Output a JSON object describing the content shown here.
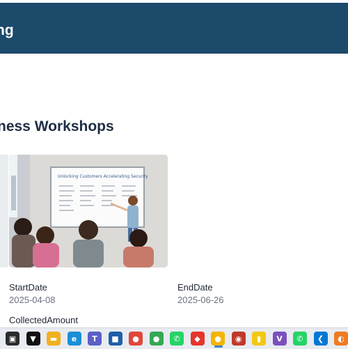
{
  "header": {
    "title": "ng"
  },
  "page": {
    "section_title": "ness Workshops"
  },
  "card": {
    "image_alt": "Workshop presenter at whiteboard with audience",
    "whiteboard_heading": "Unlocking Customers Accelerating Security"
  },
  "fields": {
    "start_label": "StartDate",
    "start_value": "2025-04-08",
    "end_label": "EndDate",
    "end_value": "2025-06-26",
    "collected_label": "CollectedAmount"
  },
  "taskbar": {
    "icons": [
      {
        "name": "task-view-icon",
        "color": "#2b2b2b",
        "glyph": "▣"
      },
      {
        "name": "store-icon",
        "color": "#111111",
        "glyph": "▼"
      },
      {
        "name": "file-explorer-icon",
        "color": "#f2b01e",
        "glyph": "▬"
      },
      {
        "name": "edge-icon",
        "color": "#1b8fd6",
        "glyph": "e"
      },
      {
        "name": "teams-icon",
        "color": "#5b5fc7",
        "glyph": "T"
      },
      {
        "name": "app-blue-icon",
        "color": "#1f5fa8",
        "glyph": "■"
      },
      {
        "name": "chrome-icon",
        "color": "#e2463a",
        "glyph": "●"
      },
      {
        "name": "chrome-profile-icon",
        "color": "#34a853",
        "glyph": "●"
      },
      {
        "name": "whatsapp-icon",
        "color": "#25d366",
        "glyph": "✆"
      },
      {
        "name": "anydesk-icon",
        "color": "#e5352b",
        "glyph": "◆"
      },
      {
        "name": "chrome-active-icon",
        "color": "#f4b400",
        "glyph": "●"
      },
      {
        "name": "app-red-icon",
        "color": "#c0392b",
        "glyph": "◉"
      },
      {
        "name": "power-bi-icon",
        "color": "#f2c811",
        "glyph": "▮"
      },
      {
        "name": "vs-icon",
        "color": "#7b4fbf",
        "glyph": "V"
      },
      {
        "name": "whatsapp-2-icon",
        "color": "#25d366",
        "glyph": "✆"
      },
      {
        "name": "vscode-icon",
        "color": "#0078d4",
        "glyph": "❮"
      },
      {
        "name": "app-orange-icon",
        "color": "#ef7a22",
        "glyph": "◐"
      }
    ]
  }
}
